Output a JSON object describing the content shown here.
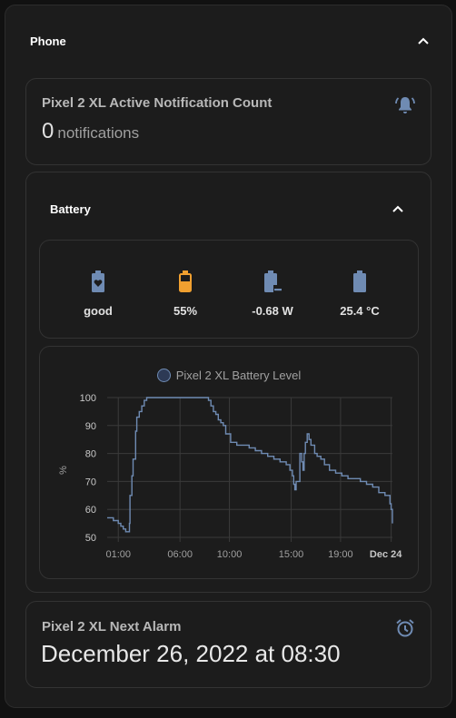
{
  "phone": {
    "title": "Phone"
  },
  "notification": {
    "name": "Pixel 2 XL Active Notification Count",
    "value": "0",
    "unit": "notifications",
    "icon": "bell-ring-icon"
  },
  "battery": {
    "title": "Battery",
    "stats": [
      {
        "label": "good",
        "icon": "battery-heart-icon",
        "color": "#6f8bb3"
      },
      {
        "label": "55%",
        "icon": "battery-50-icon",
        "color": "#f0a030"
      },
      {
        "label": "-0.68 W",
        "icon": "battery-minus-icon",
        "color": "#6f8bb3"
      },
      {
        "label": "25.4 °C",
        "icon": "battery-temperature-icon",
        "color": "#6f8bb3"
      }
    ]
  },
  "chart_data": {
    "type": "line",
    "title": "",
    "legend": "Pixel 2 XL Battery Level",
    "ylabel": "%",
    "xlabel": "",
    "ylim": [
      50,
      100
    ],
    "yticks": [
      "100",
      "90",
      "80",
      "70",
      "60",
      "50"
    ],
    "xticks": [
      "01:00",
      "06:00",
      "10:00",
      "15:00",
      "19:00",
      "Dec 24"
    ],
    "x_hours": [
      0.0,
      0.3,
      0.5,
      0.7,
      0.9,
      1.1,
      1.3,
      1.5,
      1.7,
      1.8,
      1.85,
      2.0,
      2.1,
      2.3,
      2.4,
      2.6,
      2.8,
      3.0,
      3.2,
      3.5,
      4.0,
      5.0,
      6.0,
      7.0,
      8.0,
      8.2,
      8.4,
      8.6,
      8.8,
      9.0,
      9.2,
      9.4,
      9.6,
      10.0,
      10.5,
      11.0,
      11.5,
      12.0,
      12.5,
      13.0,
      13.5,
      14.0,
      14.5,
      14.8,
      15.0,
      15.1,
      15.2,
      15.3,
      15.6,
      15.75,
      15.85,
      15.95,
      16.05,
      16.2,
      16.35,
      16.5,
      16.8,
      17.0,
      17.3,
      17.6,
      18.0,
      18.5,
      19.0,
      19.5,
      20.0,
      20.5,
      21.0,
      21.5,
      22.0,
      22.5,
      22.9,
      23.0,
      23.1
    ],
    "values": [
      57,
      57,
      56,
      56,
      55,
      54,
      53,
      52,
      52,
      55,
      65,
      72,
      78,
      88,
      93,
      95,
      97,
      99,
      100,
      100,
      100,
      100,
      100,
      100,
      100,
      99,
      97,
      95,
      94,
      92,
      91,
      90,
      87,
      84,
      83,
      83,
      82,
      81,
      80,
      79,
      78,
      77,
      76,
      74,
      72,
      69,
      67,
      70,
      80,
      77,
      74,
      80,
      84,
      87,
      85,
      83,
      80,
      79,
      78,
      76,
      74,
      73,
      72,
      71,
      71,
      70,
      69,
      68,
      66,
      65,
      62,
      60,
      55
    ],
    "series_color": "#6f8bb3",
    "grid": true
  },
  "alarm": {
    "name": "Pixel 2 XL Next Alarm",
    "value": "December 26, 2022 at 08:30",
    "icon": "alarm-icon"
  }
}
